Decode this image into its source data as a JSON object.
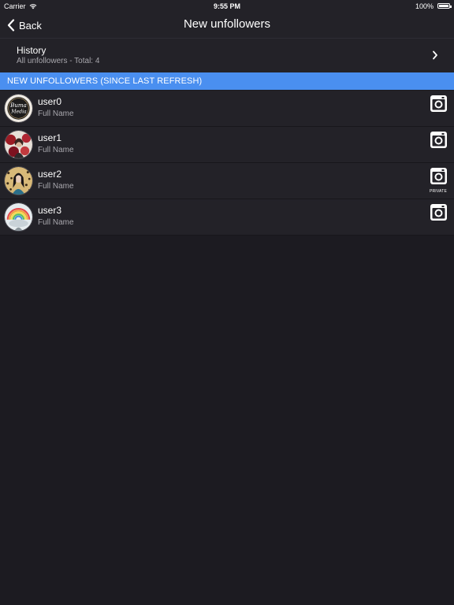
{
  "status_bar": {
    "carrier": "Carrier",
    "time": "9:55 PM",
    "battery": "100%"
  },
  "nav": {
    "back_label": "Back",
    "title": "New unfollowers"
  },
  "history": {
    "title": "History",
    "subtitle": "All unfollowers - Total: 4"
  },
  "section_header": "NEW UNFOLLOWERS (SINCE LAST REFRESH)",
  "users": [
    {
      "username": "user0",
      "full_name": "Full Name",
      "private": false,
      "avatar_logo_line1": "Buma",
      "avatar_logo_line2": "Media"
    },
    {
      "username": "user1",
      "full_name": "Full Name",
      "private": false
    },
    {
      "username": "user2",
      "full_name": "Full Name",
      "private": true,
      "private_label": "PRIVATE"
    },
    {
      "username": "user3",
      "full_name": "Full Name",
      "private": false
    }
  ],
  "colors": {
    "background": "#1c1b21",
    "row": "#232228",
    "accent": "#4a8ff0",
    "secondary_text": "#a8a7ad"
  },
  "icons": {
    "back": "chevron-left-icon",
    "history": "chevron-right-icon",
    "profile_link": "instagram-icon",
    "wifi": "wifi-icon",
    "battery": "battery-icon"
  }
}
